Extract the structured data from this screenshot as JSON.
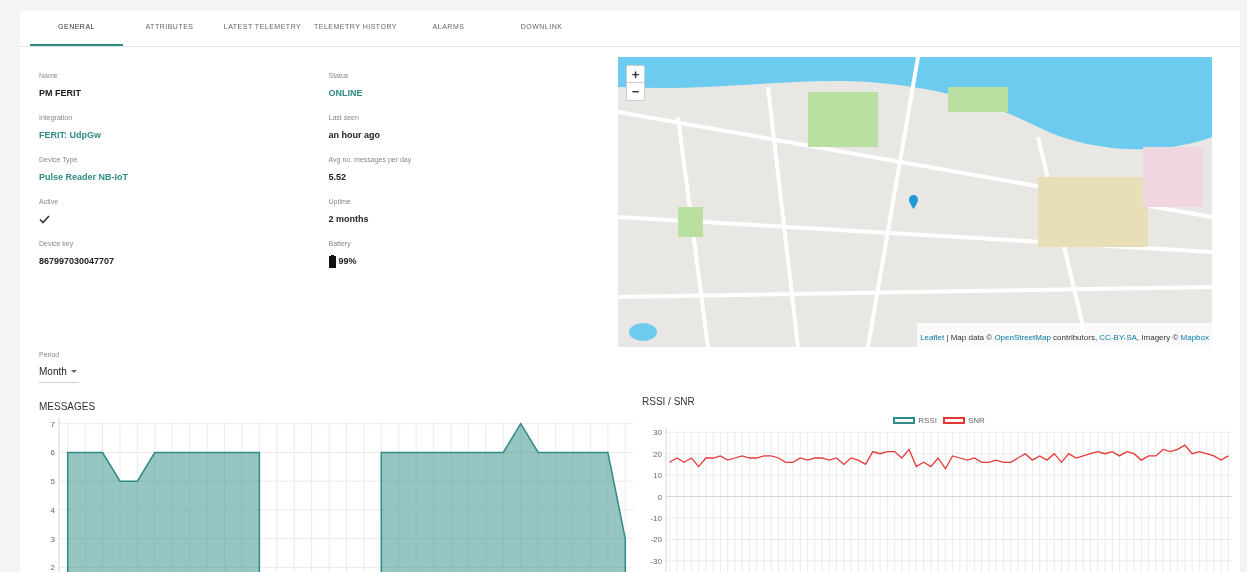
{
  "tabs": [
    {
      "label": "GENERAL",
      "selected": true
    },
    {
      "label": "ATTRIBUTES",
      "selected": false
    },
    {
      "label": "LATEST TELEMETRY",
      "selected": false
    },
    {
      "label": "TELEMETRY HISTORY",
      "selected": false
    },
    {
      "label": "ALARMS",
      "selected": false
    },
    {
      "label": "DOWNLINK",
      "selected": false
    }
  ],
  "details": {
    "columns": [
      [
        {
          "label": "Name",
          "kind": "text",
          "value": "PM FERIT"
        },
        {
          "label": "Integration",
          "kind": "link",
          "value": "FERIT: UdpGw"
        },
        {
          "label": "Device Type",
          "kind": "link",
          "value": "Pulse Reader NB-IoT"
        },
        {
          "label": "Active",
          "kind": "check",
          "checked": true
        },
        {
          "label": "Device key",
          "kind": "text",
          "value": "867997030047707"
        }
      ],
      [
        {
          "label": "Status",
          "kind": "status",
          "value": "ONLINE",
          "online": true
        },
        {
          "label": "Last seen",
          "kind": "text",
          "value": "an hour ago"
        },
        {
          "label": "Avg no. messages per day",
          "kind": "text",
          "value": "5.52"
        },
        {
          "label": "Uptime",
          "kind": "text",
          "value": "2 months"
        },
        {
          "label": "Battery",
          "kind": "battery",
          "value": "99%",
          "level": 0.99
        }
      ]
    ]
  },
  "map": {
    "zoom_in": "+",
    "zoom_out": "−",
    "attribution": [
      {
        "text": "Leaflet",
        "link": true
      },
      {
        "text": " | Map data © ",
        "link": false
      },
      {
        "text": "OpenStreetMap",
        "link": true
      },
      {
        "text": " contributors, ",
        "link": false
      },
      {
        "text": "CC-BY-SA",
        "link": true
      },
      {
        "text": ", Imagery © ",
        "link": false
      },
      {
        "text": "Mapbox",
        "link": true
      }
    ]
  },
  "period": {
    "label": "Period",
    "value": "Month"
  },
  "messages": {
    "title": "MESSAGES",
    "chart_data": {
      "type": "area",
      "categories": [
        null,
        null,
        null,
        null,
        null,
        null,
        null,
        null,
        null,
        null,
        null,
        null,
        null,
        null,
        null,
        null,
        null,
        null,
        null,
        null,
        null,
        null,
        null,
        null,
        null,
        null,
        null,
        null,
        null,
        null,
        null,
        null,
        null
      ],
      "series": [
        {
          "color": "#2e8b86",
          "values": [
            6,
            6,
            6,
            5,
            5,
            6,
            6,
            6,
            6,
            6,
            6,
            6,
            null,
            null,
            null,
            null,
            null,
            null,
            6,
            6,
            6,
            6,
            6,
            6,
            6,
            6,
            7,
            6,
            6,
            6,
            6,
            6,
            3
          ]
        }
      ],
      "grid": true,
      "ylim": [
        1.7,
        7.2
      ],
      "yticks": [
        2,
        3,
        4,
        5,
        6,
        7
      ]
    }
  },
  "rssi": {
    "title": "RSSI / SNR",
    "chart_data": {
      "type": "line",
      "categories": [
        null,
        null,
        null,
        null,
        null,
        null,
        null,
        null,
        null,
        null,
        null,
        null,
        null,
        null,
        null,
        null,
        null,
        null,
        null,
        null,
        null,
        null,
        null,
        null,
        null,
        null,
        null,
        null,
        null,
        null,
        null,
        null,
        null,
        null,
        null,
        null,
        null,
        null,
        null,
        null,
        null,
        null,
        null,
        null,
        null,
        null,
        null,
        null,
        null,
        null,
        null,
        null,
        null,
        null,
        null,
        null,
        null,
        null,
        null,
        null,
        null,
        null,
        null,
        null,
        null,
        null,
        null,
        null,
        null,
        null,
        null,
        null,
        null,
        null,
        null,
        null,
        null,
        null
      ],
      "series": [
        {
          "name": "RSSI",
          "color": "#2e8b86",
          "values": [
            null,
            null,
            null,
            null,
            null,
            null,
            null,
            null,
            null,
            null,
            null,
            null,
            null,
            null,
            null,
            null,
            null,
            null,
            null,
            null,
            null,
            null,
            null,
            null,
            null,
            null,
            null,
            null,
            null,
            null,
            null,
            null,
            null,
            null,
            null,
            null,
            null,
            null,
            null,
            null,
            null,
            null,
            null,
            null,
            null,
            null,
            null,
            null,
            null,
            null,
            null,
            null,
            null,
            null,
            null,
            null,
            null,
            null,
            null,
            null,
            null,
            null,
            null,
            null,
            null,
            null,
            null,
            null,
            null,
            null,
            null,
            null,
            null,
            null,
            null,
            null,
            null,
            null
          ]
        },
        {
          "name": "SNR",
          "color": "#e53935",
          "values": [
            16,
            18,
            16,
            18,
            14,
            18,
            18,
            19,
            17,
            18,
            19,
            18,
            18,
            19,
            19,
            18,
            16,
            16,
            18,
            17,
            18,
            18,
            17,
            18,
            15,
            18,
            17,
            15,
            21,
            20,
            21,
            21,
            18,
            22,
            14,
            16,
            14,
            18,
            13,
            19,
            18,
            17,
            18,
            16,
            16,
            17,
            16,
            16,
            18,
            20,
            17,
            19,
            17,
            20,
            16,
            20,
            18,
            19,
            20,
            21,
            20,
            21,
            19,
            21,
            20,
            17,
            19,
            19,
            22,
            21,
            22,
            24,
            20,
            21,
            20,
            19,
            17,
            19
          ]
        }
      ],
      "grid": true,
      "ylim": [
        -38,
        32
      ],
      "yticks": [
        30,
        20,
        10,
        0,
        -10,
        -20,
        -30
      ]
    }
  }
}
